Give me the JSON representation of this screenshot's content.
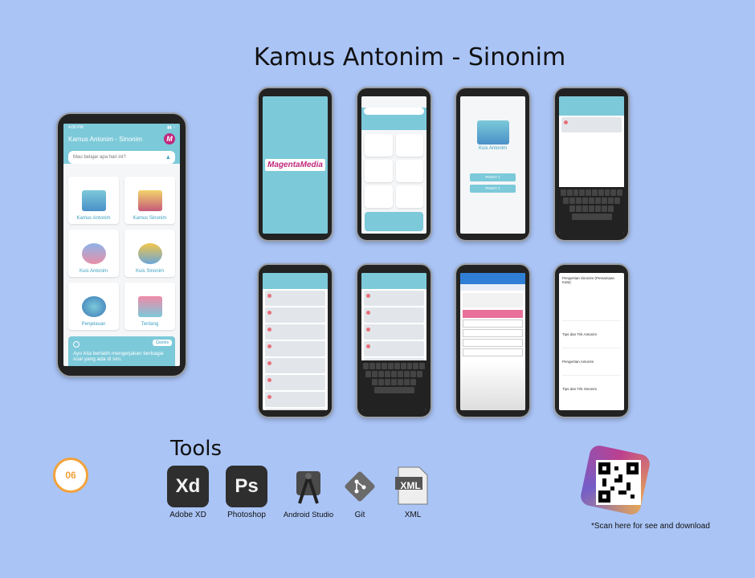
{
  "page": {
    "title": "Kamus Antonim - Sinonim"
  },
  "main_phone": {
    "status_time": "4:00 PM",
    "app_title": "Kamus Antonim - Sinonim",
    "logo_letter": "M",
    "search_placeholder": "Mau belajar apa hari ini?",
    "menu": [
      {
        "label": "Kamus Antonim"
      },
      {
        "label": "Kamus Sinonim"
      },
      {
        "label": "Kuis Antonim"
      },
      {
        "label": "Kuis Sinonim"
      },
      {
        "label": "Penjelasan"
      },
      {
        "label": "Tentang"
      }
    ],
    "quote_button": "Quotes",
    "quote_text": "Ayo kita berlatih mengerjakan berbagai soal yang ada di sini."
  },
  "splash": {
    "brand": "MagentaMedia"
  },
  "quiz_phone": {
    "title": "Kuis Antonim",
    "buttons": [
      "PAKET 1",
      "PAKET 2"
    ]
  },
  "theory_phone": {
    "items": [
      "Pengertian Sinonim (Persamaan Kata)",
      "Tips dan Trik Antonim",
      "Pengertian Antonim",
      "Tips dan Trik Sinonim"
    ]
  },
  "tools": {
    "heading": "Tools",
    "badge": "06",
    "items": [
      {
        "label": "Adobe XD",
        "glyph": "Xd",
        "icon": "adobe-xd-icon",
        "bg": "#2e2e2e",
        "fg": "#f2f2f2"
      },
      {
        "label": "Photoshop",
        "glyph": "Ps",
        "icon": "photoshop-icon",
        "bg": "#2e2e2e",
        "fg": "#f2f2f2"
      },
      {
        "label": "Android Studio",
        "glyph": "",
        "icon": "android-studio-icon",
        "bg": "transparent",
        "fg": "#333"
      },
      {
        "label": "Git",
        "glyph": "",
        "icon": "git-icon",
        "bg": "transparent",
        "fg": "#555"
      },
      {
        "label": "XML",
        "glyph": "XML",
        "icon": "xml-file-icon",
        "bg": "transparent",
        "fg": "#444"
      }
    ]
  },
  "qr": {
    "caption": "*Scan here for see and download"
  }
}
